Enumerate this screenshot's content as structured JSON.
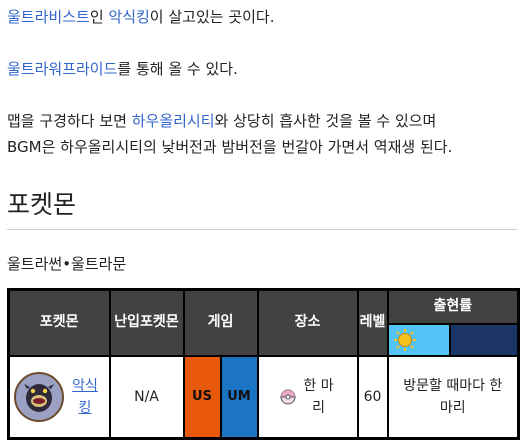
{
  "intro": {
    "line1": {
      "link": "울트라비스트",
      "mid": "인 ",
      "link2": "악식킹",
      "rest": "이 살고있는 곳이다."
    },
    "line2": {
      "link": "울트라워프라이드",
      "rest": "를 통해 올 수 있다."
    },
    "line3": {
      "pre": "맵을 구경하다 보면 ",
      "link": "하우올리시티",
      "rest": "와 상당히 흡사한 것을 볼 수 있으며"
    },
    "line4": {
      "text": "BGM은 하우올리시티의 낮버전과 밤버전을 번갈아 가면서 역재생 된다."
    }
  },
  "section": {
    "title": "포켓몬",
    "subtitle": "울트라썬•울트라문"
  },
  "table": {
    "headers": {
      "pokemon": "포켓몬",
      "intrusion": "난입포켓몬",
      "game": "게임",
      "location": "장소",
      "level": "레벨",
      "appearance": "출현률"
    },
    "rows": [
      {
        "pokemon": "악식킹",
        "intrusion": "N/A",
        "game_us": "US",
        "game_um": "UM",
        "location": "한 마리",
        "level": "60",
        "appearance": "방문할 때마다 한 마리"
      }
    ],
    "colors": {
      "us": "#e8590c",
      "um": "#1c74c4",
      "day": "#52c4f5",
      "night": "#1a3566",
      "header": "#424242"
    },
    "icons": {
      "day": "sun-icon",
      "night": "moon-icon",
      "ball": "dream-ball-icon",
      "portrait": "guzzlord-portrait-icon"
    }
  }
}
